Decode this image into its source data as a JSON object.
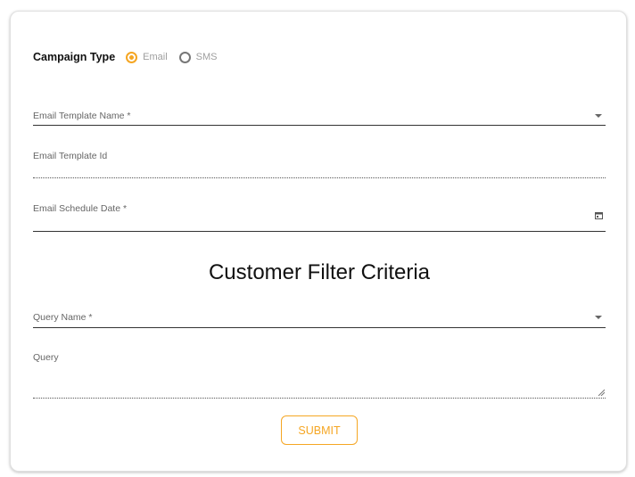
{
  "campaign_type": {
    "label": "Campaign Type",
    "options": [
      {
        "label": "Email",
        "selected": true
      },
      {
        "label": "SMS",
        "selected": false
      }
    ]
  },
  "fields": {
    "email_template_name": {
      "label": "Email Template Name *",
      "value": ""
    },
    "email_template_id": {
      "label": "Email Template Id",
      "value": ""
    },
    "email_schedule_date": {
      "label": "Email Schedule Date *",
      "value": ""
    }
  },
  "customer_filter": {
    "title": "Customer Filter Criteria",
    "query_name": {
      "label": "Query Name *",
      "value": ""
    },
    "query": {
      "label": "Query",
      "value": ""
    }
  },
  "submit_label": "SUBMIT",
  "colors": {
    "accent": "#f5a623",
    "text": "#111111",
    "muted": "#9e9e9e"
  },
  "icons": {
    "dropdown": "chevron-down-icon",
    "date": "calendar-icon",
    "resize": "resize-handle-icon",
    "radio_selected": "radio-checked-icon",
    "radio_unselected": "radio-unchecked-icon"
  }
}
